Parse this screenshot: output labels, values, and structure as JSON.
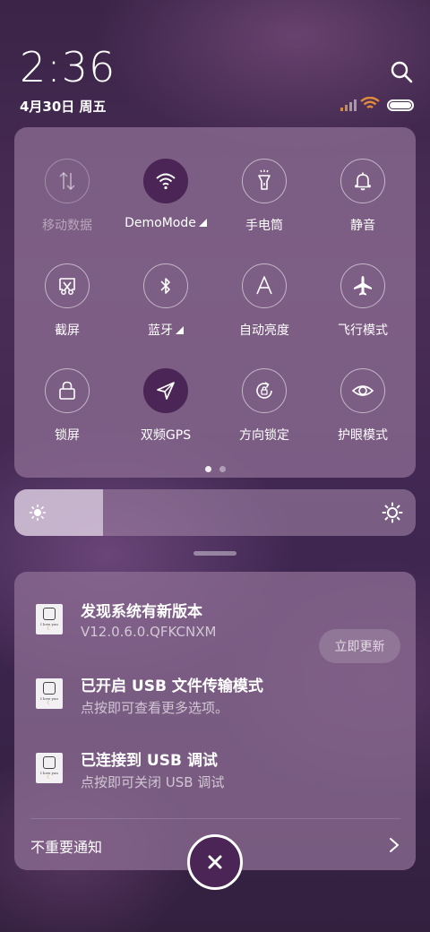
{
  "status": {
    "time": "2:36",
    "date": "4月30日 周五"
  },
  "quick_settings": {
    "tiles": [
      {
        "label": "移动数据",
        "icon": "mobile-data-icon",
        "state": "disabled"
      },
      {
        "label": "DemoMode",
        "icon": "wifi-icon",
        "state": "active",
        "has_more": true
      },
      {
        "label": "手电筒",
        "icon": "flashlight-icon",
        "state": "off"
      },
      {
        "label": "静音",
        "icon": "bell-icon",
        "state": "off"
      },
      {
        "label": "截屏",
        "icon": "screenshot-icon",
        "state": "off"
      },
      {
        "label": "蓝牙",
        "icon": "bluetooth-icon",
        "state": "off",
        "has_more": true
      },
      {
        "label": "自动亮度",
        "icon": "auto-brightness-icon",
        "state": "off"
      },
      {
        "label": "飞行模式",
        "icon": "airplane-icon",
        "state": "off"
      },
      {
        "label": "锁屏",
        "icon": "lock-icon",
        "state": "off"
      },
      {
        "label": "双频GPS",
        "icon": "location-arrow-icon",
        "state": "active"
      },
      {
        "label": "方向锁定",
        "icon": "rotation-lock-icon",
        "state": "off"
      },
      {
        "label": "护眼模式",
        "icon": "eye-icon",
        "state": "off"
      }
    ],
    "page_count": 2,
    "current_page": 1
  },
  "brightness": {
    "level": 0.22
  },
  "notifications": [
    {
      "title": "发现系统有新版本",
      "subtitle": "V12.0.6.0.QFKCNXM",
      "action": "立即更新",
      "icon_text": "I love you"
    },
    {
      "title": "已开启 USB 文件传输模式",
      "subtitle": "点按即可查看更多选项。",
      "icon_text": "I love you"
    },
    {
      "title": "已连接到 USB 调试",
      "subtitle": "点按即可关闭 USB 调试",
      "icon_text": "I love you"
    }
  ],
  "minor_notifications_label": "不重要通知",
  "colors": {
    "active": "#4a2555",
    "panel": "#8c6c92"
  }
}
